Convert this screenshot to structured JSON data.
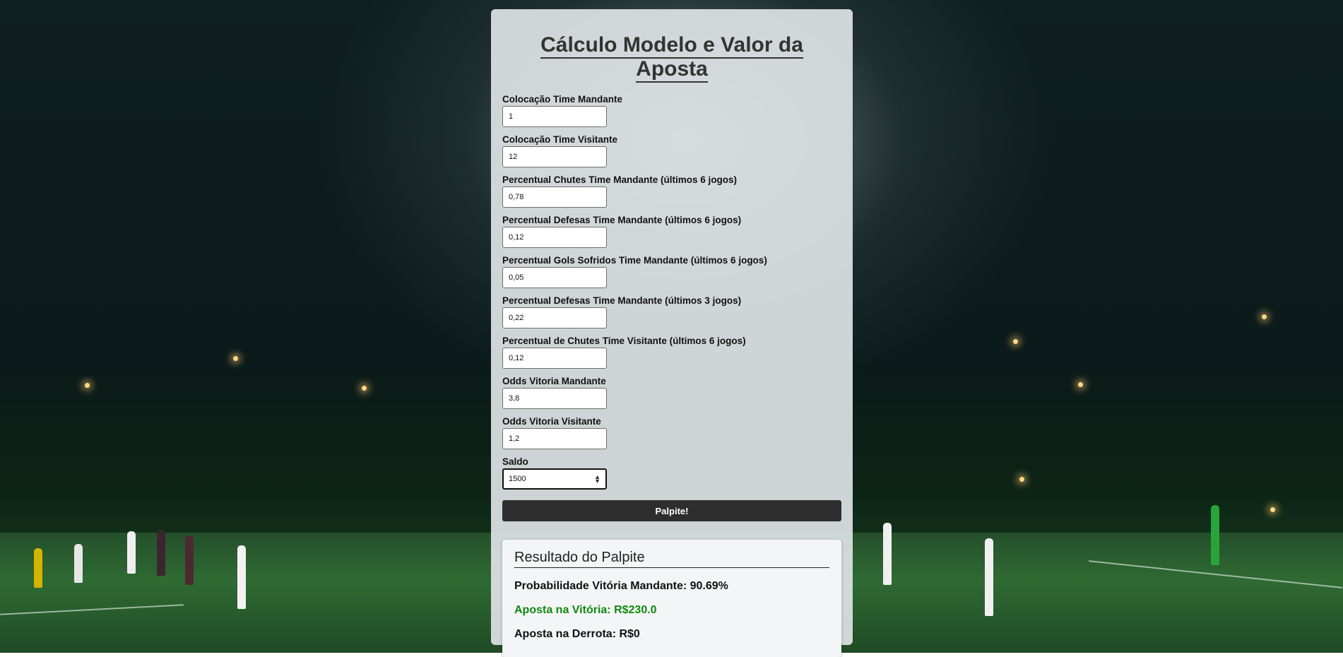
{
  "page": {
    "title": "Cálculo Modelo e Valor da Aposta"
  },
  "form": {
    "fields": [
      {
        "label": "Colocação Time Mandante",
        "value": "1"
      },
      {
        "label": "Colocação Time Visitante",
        "value": "12"
      },
      {
        "label": "Percentual Chutes Time Mandante (últimos 6 jogos)",
        "value": "0,78"
      },
      {
        "label": "Percentual Defesas Time Mandante (últimos 6 jogos)",
        "value": "0,12"
      },
      {
        "label": "Percentual Gols Sofridos Time Mandante (últimos 6 jogos)",
        "value": "0,05"
      },
      {
        "label": "Percentual Defesas Time Mandante (últimos 3 jogos)",
        "value": "0,22"
      },
      {
        "label": "Percentual de Chutes Time Visitante (últimos 6 jogos)",
        "value": "0,12"
      },
      {
        "label": "Odds Vitoria Mandante",
        "value": "3,8"
      },
      {
        "label": "Odds Vitoria Visitante",
        "value": "1,2"
      },
      {
        "label": "Saldo",
        "value": "1500"
      }
    ],
    "submit_label": "Palpite!"
  },
  "result": {
    "heading": "Resultado do Palpite",
    "probability": "Probabilidade Vitória Mandante: 90.69%",
    "win_bet": "Aposta na Vitória: R$230.0",
    "loss_bet": "Aposta na Derrota: R$0"
  },
  "colors": {
    "button_bg": "#2e2e2e",
    "win_text": "#0f8a0f",
    "panel_bg": "#dee2e4"
  }
}
